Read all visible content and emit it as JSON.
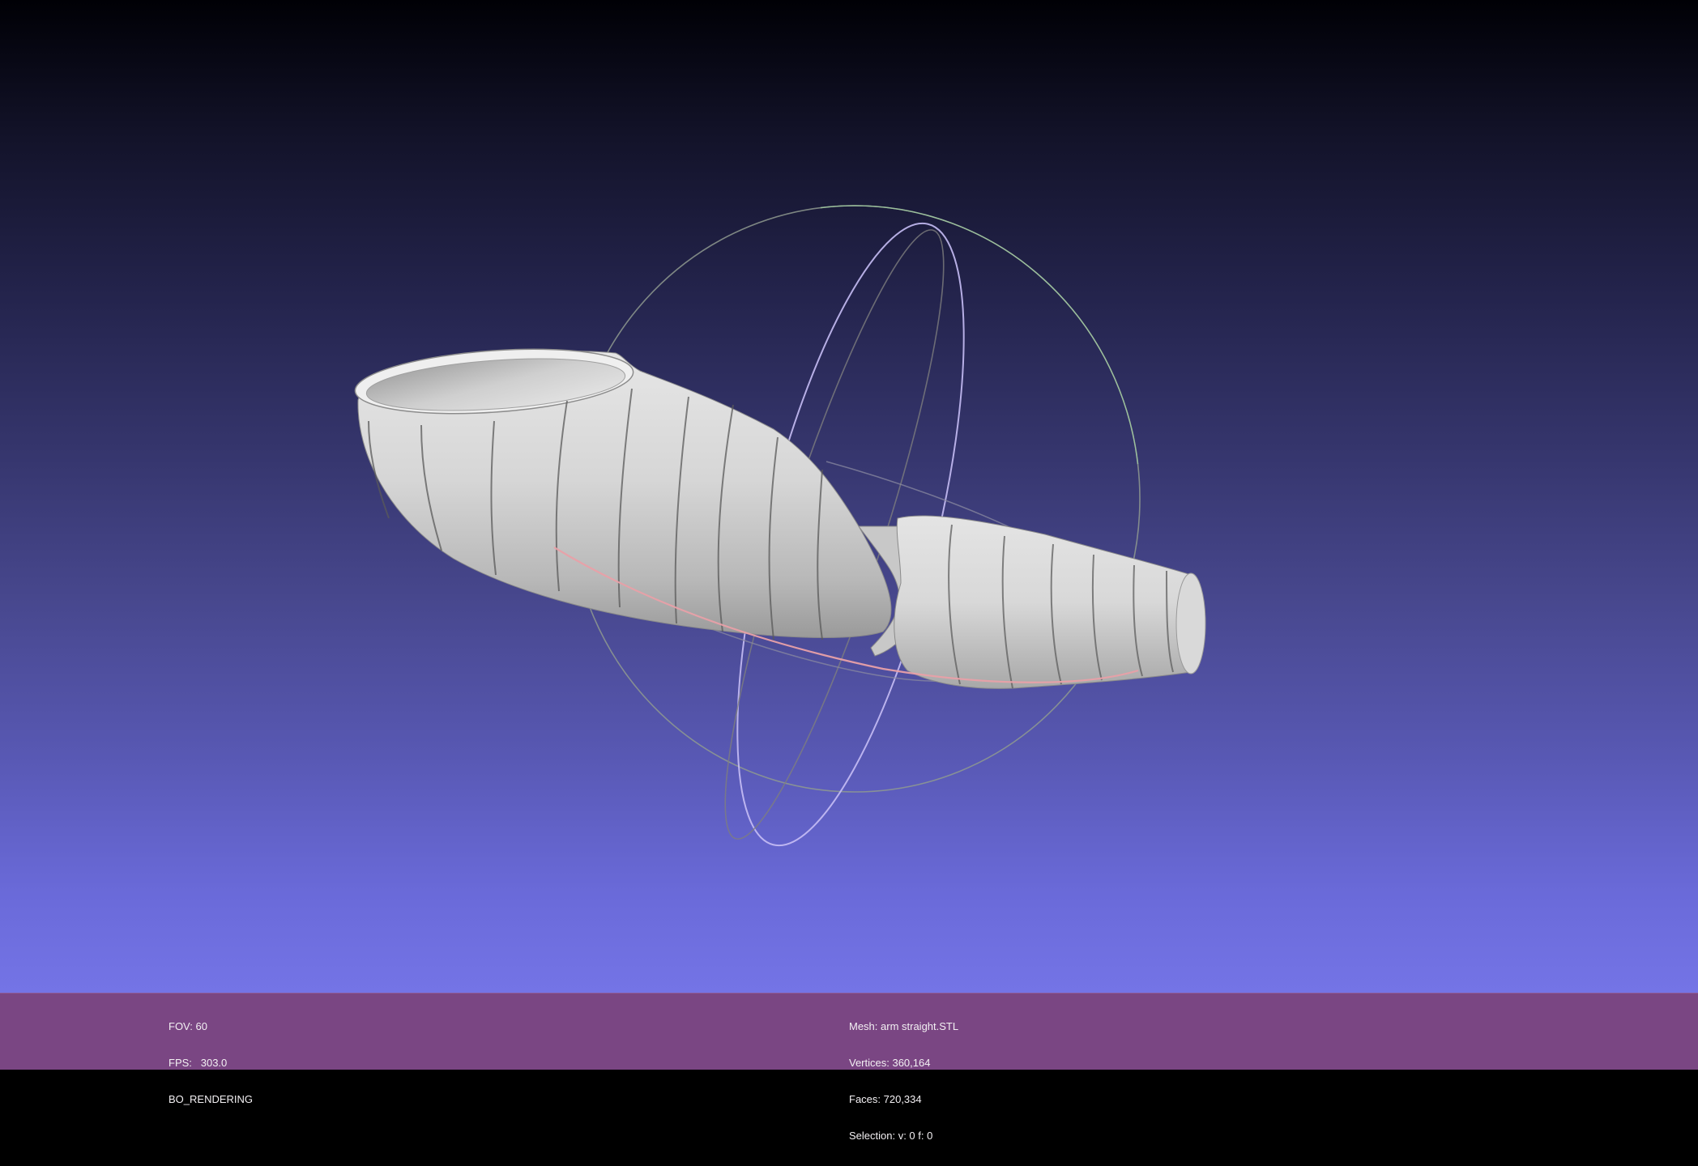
{
  "viewport": {
    "mesh_color": "#dcdcdc",
    "background_top": "#000005",
    "background_bottom": "#7474e6",
    "trackball": {
      "x_ring_color": "#e8a0a8",
      "y_ring_color": "#9fc79f",
      "z_ring_color": "#b0a8f0",
      "outer_ring_color": "#8a8a8a"
    }
  },
  "status": {
    "left": {
      "fov": "FOV: 60",
      "fps": "FPS:   303.0",
      "mode": "BO_RENDERING"
    },
    "right": {
      "mesh": "Mesh: arm straight.STL",
      "vertices": "Vertices: 360,164",
      "faces": "Faces: 720,334",
      "selection": "Selection: v: 0 f: 0"
    },
    "bar_color": "#7a4683"
  }
}
